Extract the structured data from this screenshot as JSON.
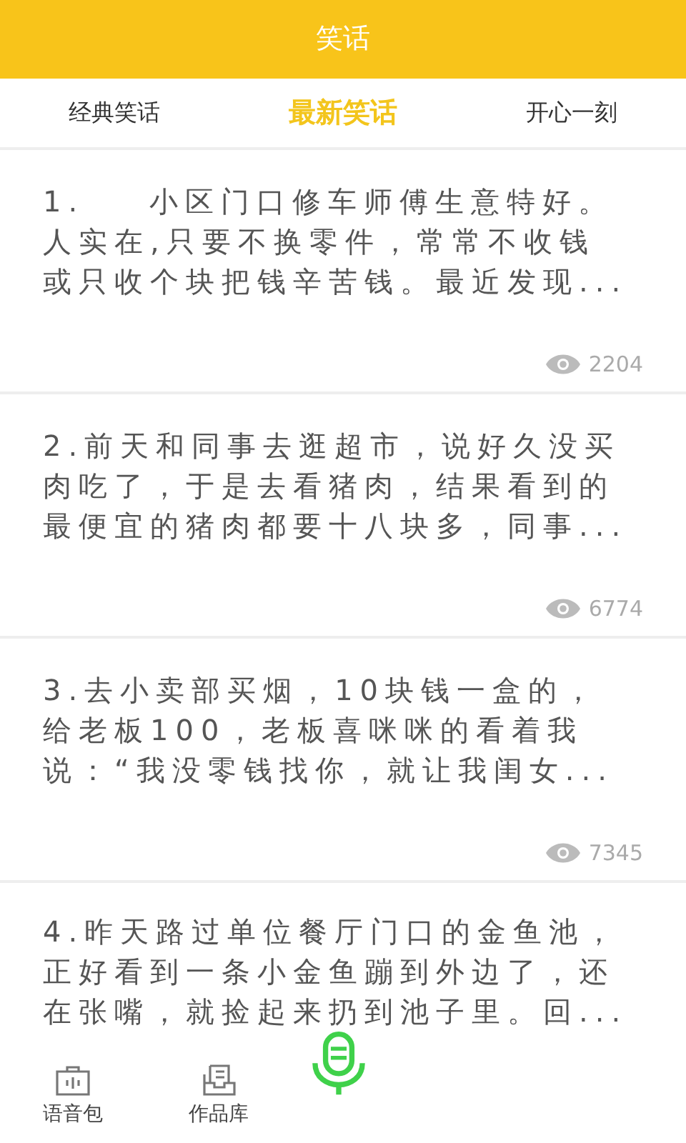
{
  "header": {
    "title": "笑话"
  },
  "tabs": [
    {
      "label": "经典笑话",
      "selected": false
    },
    {
      "label": "最新笑话",
      "selected": true
    },
    {
      "label": "开心一刻",
      "selected": false
    }
  ],
  "jokes": [
    {
      "text": "1.    小区门口修车师傅生意特好。人实在,只要不换零件，常常不收钱或只收个块把钱辛苦钱。最近发现...",
      "views": "2204"
    },
    {
      "text": "2.前天和同事去逛超市，说好久没买肉吃了，于是去看猪肉，结果看到的最便宜的猪肉都要十八块多，同事...",
      "views": "6774"
    },
    {
      "text": "3.去小卖部买烟，10块钱一盒的，给老板100，老板喜咪咪的看着我说：“我没零钱找你，就让我闺女...",
      "views": "7345"
    },
    {
      "text": "4.昨天路过单位餐厅门口的金鱼池，正好看到一条小金鱼蹦到外边了，还在张嘴，就捡起来扔到池子里。回..."
    }
  ],
  "bottom_nav": [
    {
      "kind": "tab",
      "label": "语音包"
    },
    {
      "kind": "tab",
      "label": "作品库"
    },
    {
      "kind": "mic"
    }
  ]
}
